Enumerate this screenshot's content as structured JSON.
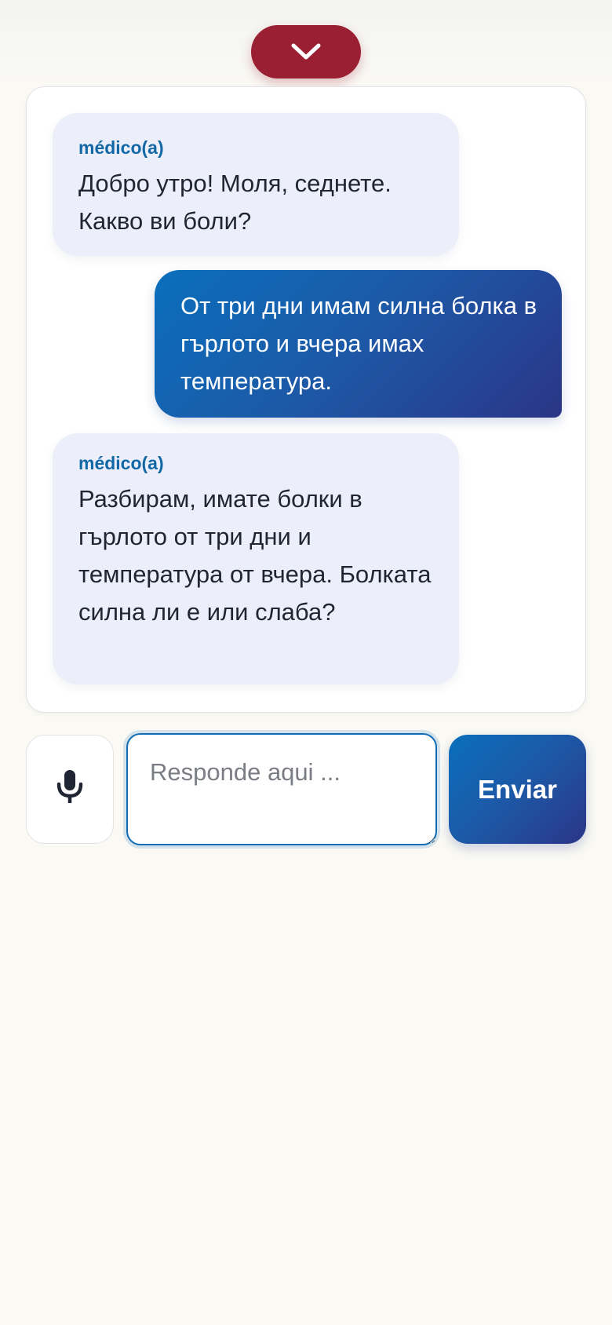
{
  "header": {
    "collapse_icon": "chevron-down-icon",
    "collapse_color": "#9b1f33"
  },
  "conversation": {
    "messages": [
      {
        "role": "doctor",
        "sender": "médico(a)",
        "text": "Добро утро! Моля, седнете. Какво ви боли?"
      },
      {
        "role": "patient",
        "text": "От три дни имам силна болка в гърлото и вчера имах температура."
      },
      {
        "role": "doctor",
        "sender": "médico(a)",
        "text": "Разбирам, имате болки в гърлото от три дни и температура от вчера. Болката силна ли е или слаба?"
      }
    ]
  },
  "composer": {
    "mic_icon": "microphone-icon",
    "placeholder": "Responde aqui ...",
    "value": "",
    "send_label": "Enviar"
  },
  "colors": {
    "accent": "#0a6fbc",
    "accent_dark": "#2b3587",
    "doctor_bubble": "#eceffa",
    "sender_label": "#1269a6",
    "background": "#faf9f4"
  }
}
